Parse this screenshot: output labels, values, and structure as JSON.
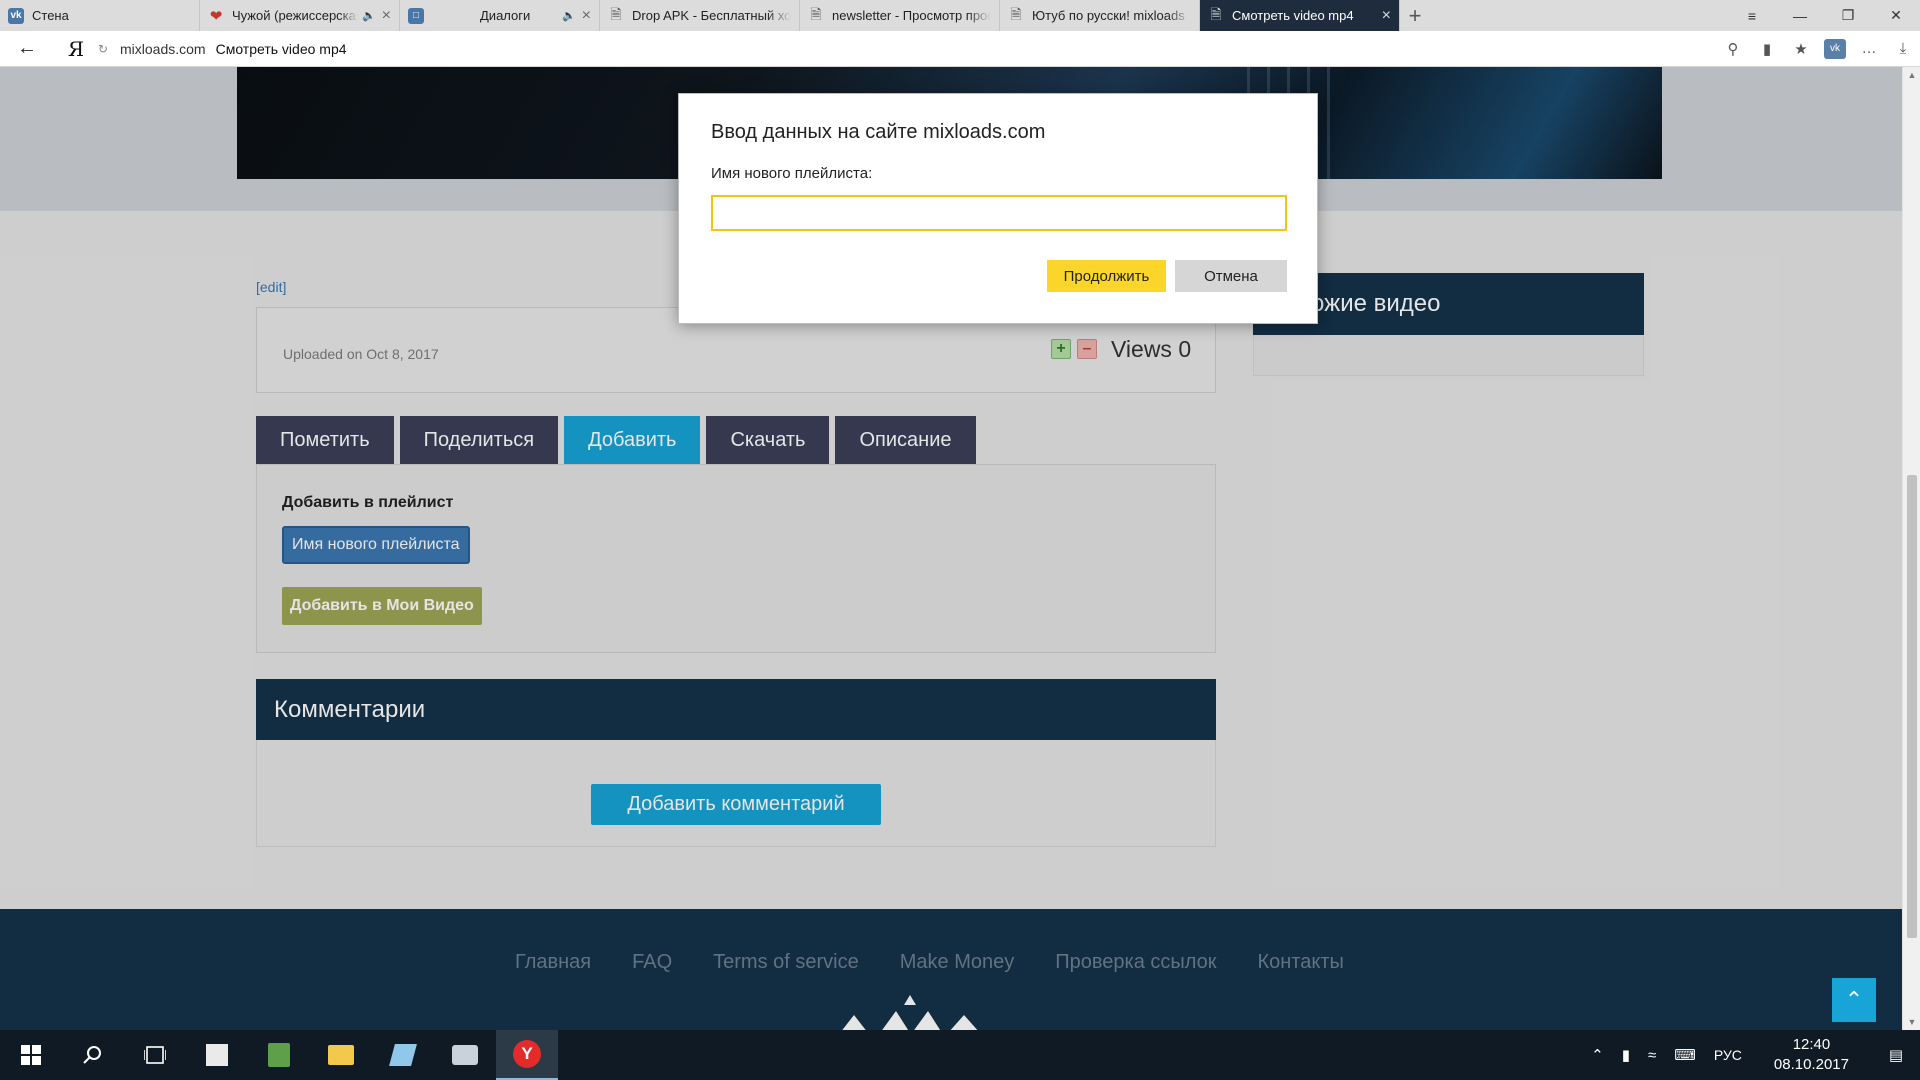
{
  "browser": {
    "tabs": [
      {
        "title": "Стена",
        "icon": "vk-icon",
        "active": false
      },
      {
        "title": "Чужой (режиссерская версия)",
        "icon": "heart-icon",
        "active": false,
        "sound": true
      },
      {
        "title": "Диалоги",
        "icon": "chat-icon",
        "active": false,
        "sound": true
      },
      {
        "title": "Drop APK - Бесплатный хостинг",
        "icon": "document-icon",
        "active": false
      },
      {
        "title": "newsletter - Просмотр профиля",
        "icon": "document-icon",
        "active": false
      },
      {
        "title": "Ютуб по русски! mixloads",
        "icon": "document-icon",
        "active": false
      },
      {
        "title": "Смотреть video mp4",
        "icon": "document-icon",
        "active": true
      }
    ],
    "address": {
      "domain": "mixloads.com",
      "page_title": "Смотреть video mp4"
    }
  },
  "page": {
    "edit_link": "[edit]",
    "uploaded": "Uploaded on Oct 8, 2017",
    "views": "Views 0",
    "tabs": [
      "Пометить",
      "Поделиться",
      "Добавить",
      "Скачать",
      "Описание"
    ],
    "active_tab": "Добавить",
    "playlist": {
      "title": "Добавить в плейлист",
      "new_playlist_button": "Имя нового плейлиста",
      "my_videos_button": "Добавить в Мои Видео"
    },
    "comments": {
      "title": "Комментарии",
      "add_button": "Добавить комментарий"
    },
    "similar": {
      "title": "Похожие видео"
    },
    "footer": {
      "links": [
        "Главная",
        "FAQ",
        "Terms of service",
        "Make Money",
        "Проверка ссылок",
        "Контакты"
      ]
    }
  },
  "dialog": {
    "title": "Ввод данных на сайте mixloads.com",
    "label": "Имя нового плейлиста:",
    "value": "",
    "ok": "Продолжить",
    "cancel": "Отмена"
  },
  "taskbar": {
    "lang": "РУС",
    "time": "12:40",
    "date": "08.10.2017"
  },
  "colors": {
    "accent_blue": "#17a4d6",
    "navy": "#15314a",
    "tab_dark": "#3b3f58",
    "dialog_yellow": "#fcd52a",
    "olive": "#9da554"
  }
}
